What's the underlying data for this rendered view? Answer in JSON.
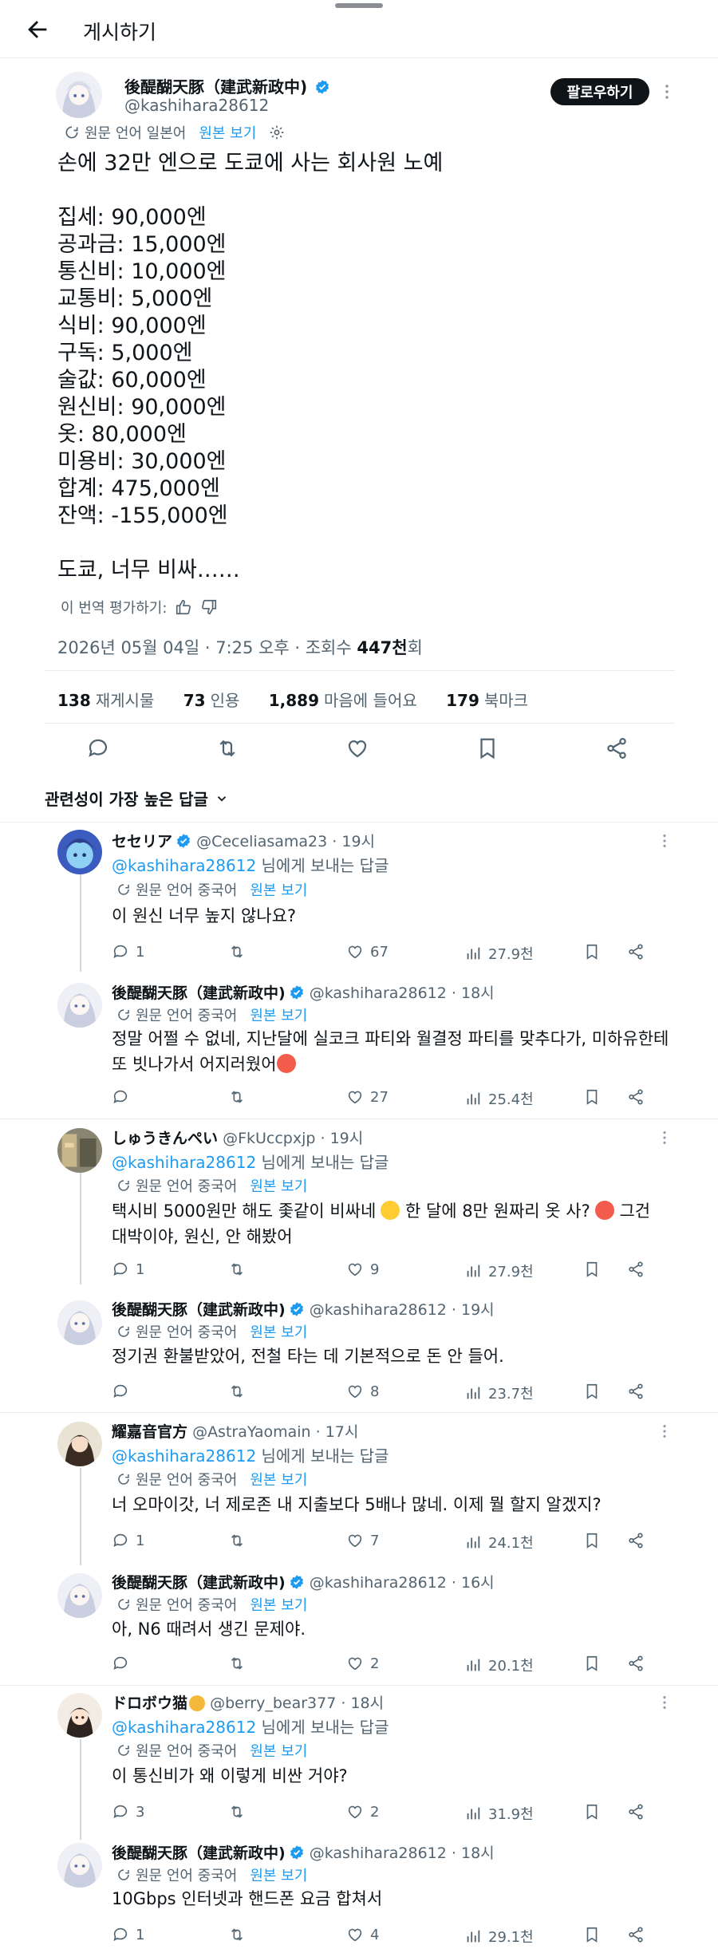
{
  "header": {
    "title": "게시하기"
  },
  "post": {
    "author_name": "後醍醐天豚（建武新政中)",
    "handle": "@kashihara28612",
    "follow_label": "팔로우하기",
    "translation_note": "원문 언어 일본어",
    "view_original": "원본 보기",
    "text": "손에 32만 엔으로 도쿄에 사는 회사원 노예\n\n집세: 90,000엔\n공과금: 15,000엔\n통신비: 10,000엔\n교통비: 5,000엔\n식비: 90,000엔\n구독: 5,000엔\n술값: 60,000엔\n원신비: 90,000엔\n옷: 80,000엔\n미용비: 30,000엔\n합계: 475,000엔\n잔액: -155,000엔\n\n도쿄, 너무 비싸……",
    "rate_translation": "이 번역 평가하기:",
    "timestamp": "2026년 05월 04일 · 7:25 오후 · 조회수 ",
    "views": "447천",
    "views_suffix": "회",
    "stats": {
      "reposts_count": "138",
      "reposts_label": "재게시물",
      "quotes_count": "73",
      "quotes_label": "인용",
      "likes_count": "1,889",
      "likes_label": "마음에 들어요",
      "bookmarks_count": "179",
      "bookmarks_label": "북마크"
    }
  },
  "sort_label": "관련성이 가장 높은 답글",
  "replies": [
    {
      "name": "セセリア",
      "handle": "@Ceceliasama23",
      "time": "· 19시",
      "reply_to": "@kashihara28612",
      "reply_to_suffix": " 님에게 보내는 답글",
      "trans": "원문 언어 중국어",
      "view": "원본 보기",
      "text": "이 원신 너무 높지 않나요?",
      "replies": "1",
      "reposts": "",
      "likes": "67",
      "views": "27.9천"
    },
    {
      "name": "後醍醐天豚（建武新政中)",
      "handle": "@kashihara28612",
      "time": "· 18시",
      "trans": "원문 언어 중국어",
      "view": "원본 보기",
      "text": "정말 어쩔 수 없네, 지난달에 실코크 파티와 월결정 파티를 맞추다가, 미하유한테\n또 빗나가서 어지러웠어",
      "replies": "",
      "reposts": "",
      "likes": "27",
      "views": "25.4천"
    },
    {
      "name": "しゅうきんぺい",
      "handle": "@FkUccpxjp",
      "time": "· 19시",
      "reply_to": "@kashihara28612",
      "reply_to_suffix": " 님에게 보내는 답글",
      "trans": "원문 언어 중국어",
      "view": "원본 보기",
      "text": "택시비 5000원만 해도 좇같이 비싸네",
      "text_mid": " 한 달에 8만 원짜리 옷 사?",
      "text_end": " 그건",
      "text_line2": "대박이야, 원신, 안 해봤어",
      "replies": "1",
      "reposts": "",
      "likes": "9",
      "views": "27.9천"
    },
    {
      "name": "後醍醐天豚（建武新政中)",
      "handle": "@kashihara28612",
      "time": "· 19시",
      "trans": "원문 언어 중국어",
      "view": "원본 보기",
      "text": "정기권 환불받았어, 전철 타는 데 기본적으로 돈 안 들어.",
      "replies": "",
      "reposts": "",
      "likes": "8",
      "views": "23.7천"
    },
    {
      "name": "耀嘉音官方",
      "handle": "@AstraYaomain",
      "time": "· 17시",
      "reply_to": "@kashihara28612",
      "reply_to_suffix": " 님에게 보내는 답글",
      "trans": "원문 언어 중국어",
      "view": "원본 보기",
      "text": "너 오마이갓, 너 제로존 내 지출보다 5배나 많네. 이제 뭘 할지 알겠지?",
      "replies": "1",
      "reposts": "",
      "likes": "7",
      "views": "24.1천"
    },
    {
      "name": "後醍醐天豚（建武新政中)",
      "handle": "@kashihara28612",
      "time": "· 16시",
      "trans": "원문 언어 중국어",
      "view": "원본 보기",
      "text": "아, N6 때려서 생긴 문제야.",
      "replies": "",
      "reposts": "",
      "likes": "2",
      "views": "20.1천"
    },
    {
      "name": "ドロボウ猫",
      "handle": "@berry_bear377",
      "time": "· 18시",
      "reply_to": "@kashihara28612",
      "reply_to_suffix": " 님에게 보내는 답글",
      "trans": "원문 언어 중국어",
      "view": "원본 보기",
      "text": "이 통신비가 왜 이렇게 비싼 거야?",
      "replies": "3",
      "reposts": "",
      "likes": "2",
      "views": "31.9천"
    },
    {
      "name": "後醍醐天豚（建武新政中)",
      "handle": "@kashihara28612",
      "time": "· 18시",
      "trans": "원문 언어 중국어",
      "view": "원본 보기",
      "text": "10Gbps 인터넷과 핸드폰 요금 합쳐서",
      "replies": "1",
      "reposts": "",
      "likes": "4",
      "views": "29.1천"
    }
  ],
  "colors": {
    "accent": "#1d9bf0",
    "text": "#0f1419",
    "muted": "#536471",
    "divider": "#e6ecf0"
  }
}
